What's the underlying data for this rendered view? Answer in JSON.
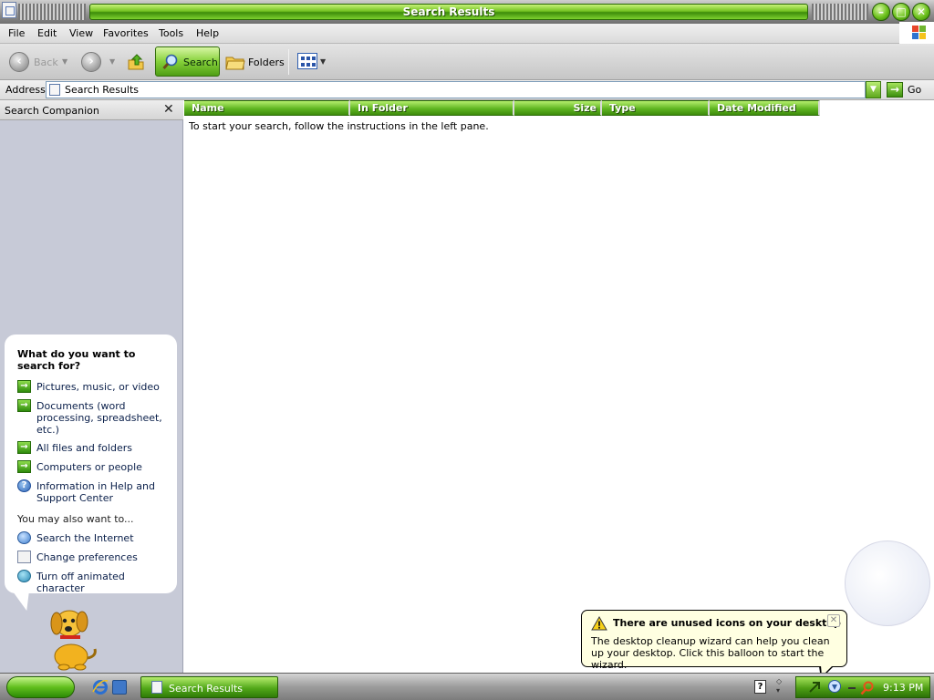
{
  "window": {
    "title": "Search Results"
  },
  "menu": {
    "file": "File",
    "edit": "Edit",
    "view": "View",
    "favorites": "Favorites",
    "tools": "Tools",
    "help": "Help"
  },
  "toolbar": {
    "back_label": "Back",
    "search_label": "Search",
    "folders_label": "Folders"
  },
  "address": {
    "label": "Address",
    "value": "Search Results",
    "go_label": "Go"
  },
  "companion": {
    "title": "Search Companion",
    "close_glyph": "✕",
    "question": "What do you want to search for?",
    "options": [
      {
        "label": "Pictures, music, or video",
        "icon": "arrow-icon"
      },
      {
        "label": "Documents (word processing, spreadsheet, etc.)",
        "icon": "arrow-icon"
      },
      {
        "label": "All files and folders",
        "icon": "arrow-icon"
      },
      {
        "label": "Computers or people",
        "icon": "arrow-icon"
      },
      {
        "label": "Information in Help and Support Center",
        "icon": "help-icon"
      }
    ],
    "also_label": "You may also want to...",
    "also": [
      {
        "label": "Search the Internet",
        "icon": "globe-icon"
      },
      {
        "label": "Change preferences",
        "icon": "preferences-icon"
      },
      {
        "label": "Turn off animated character",
        "icon": "animated-character-icon"
      }
    ]
  },
  "results": {
    "columns": [
      "Name",
      "In Folder",
      "Size",
      "Type",
      "Date Modified"
    ],
    "empty_message": "To start your search, follow the instructions in the left pane."
  },
  "balloon": {
    "title": "There are unused icons on your desktop",
    "body": "The desktop cleanup wizard can help you clean up your desktop. Click this balloon to start the wizard."
  },
  "taskbar": {
    "task_label": "Search Results",
    "clock": "9:13 PM"
  },
  "colors": {
    "accent_green": "#5fb521",
    "pane_background": "#c7cad7",
    "balloon_background": "#ffffe1"
  }
}
